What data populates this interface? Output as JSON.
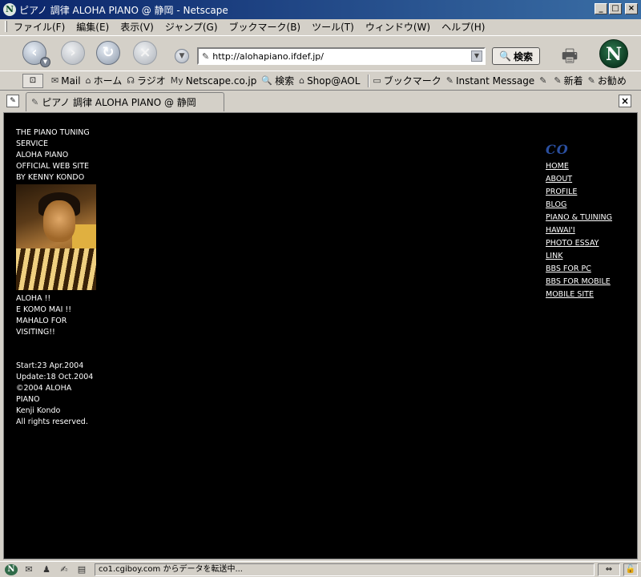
{
  "window": {
    "title": "ピアノ 調律 ALOHA PIANO @ 静岡 - Netscape",
    "app_icon": "N",
    "controls": {
      "minimize": "_",
      "maximize": "□",
      "close": "×"
    }
  },
  "menu": {
    "items": [
      "ファイル(F)",
      "編集(E)",
      "表示(V)",
      "ジャンプ(G)",
      "ブックマーク(B)",
      "ツール(T)",
      "ウィンドウ(W)",
      "ヘルプ(H)"
    ]
  },
  "nav": {
    "url": "http://alohapiano.ifdef.jp/",
    "search_label": "検索",
    "logo": "N"
  },
  "personal_toolbar": {
    "items": [
      {
        "icon": "✉",
        "label": "Mail"
      },
      {
        "icon": "⌂",
        "label": "ホーム"
      },
      {
        "icon": "☊",
        "label": "ラジオ"
      },
      {
        "icon": "My",
        "label": "Netscape.co.jp"
      },
      {
        "icon": "🔍",
        "label": "検索"
      },
      {
        "icon": "⌂",
        "label": "Shop@AOL"
      },
      {
        "icon": "▭",
        "label": "ブックマーク"
      },
      {
        "icon": "✎",
        "label": "Instant Message"
      },
      {
        "icon": "✎",
        "label": ""
      },
      {
        "icon": "✎",
        "label": "新着"
      },
      {
        "icon": "✎",
        "label": "お勧め"
      }
    ]
  },
  "tab": {
    "label": "ピアノ 調律 ALOHA PIANO @ 静岡"
  },
  "page": {
    "intro_lines": [
      "THE PIANO TUNING",
      "SERVICE",
      "ALOHA PIANO",
      "OFFICIAL WEB SITE",
      "BY KENNY KONDO"
    ],
    "greeting_lines": [
      "ALOHA !!",
      "E KOMO MAI !!",
      "MAHALO FOR",
      "VISITING!!"
    ],
    "footer_lines": [
      "Start:23 Apr.2004",
      "Update:18 Oct.2004",
      "©2004 ALOHA",
      "PIANO",
      "Kenji Kondo",
      "All rights reserved."
    ],
    "nav_logo": "CO",
    "nav_links": [
      "HOME",
      "ABOUT",
      "PROFILE",
      "BLOG",
      "PIANO & TUINING",
      "HAWAI'I",
      "PHOTO ESSAY",
      "LINK",
      "BBS FOR PC",
      "BBS FOR MOBILE",
      "MOBILE SITE"
    ]
  },
  "status": {
    "text": "co1.cgiboy.com からデータを転送中..."
  }
}
